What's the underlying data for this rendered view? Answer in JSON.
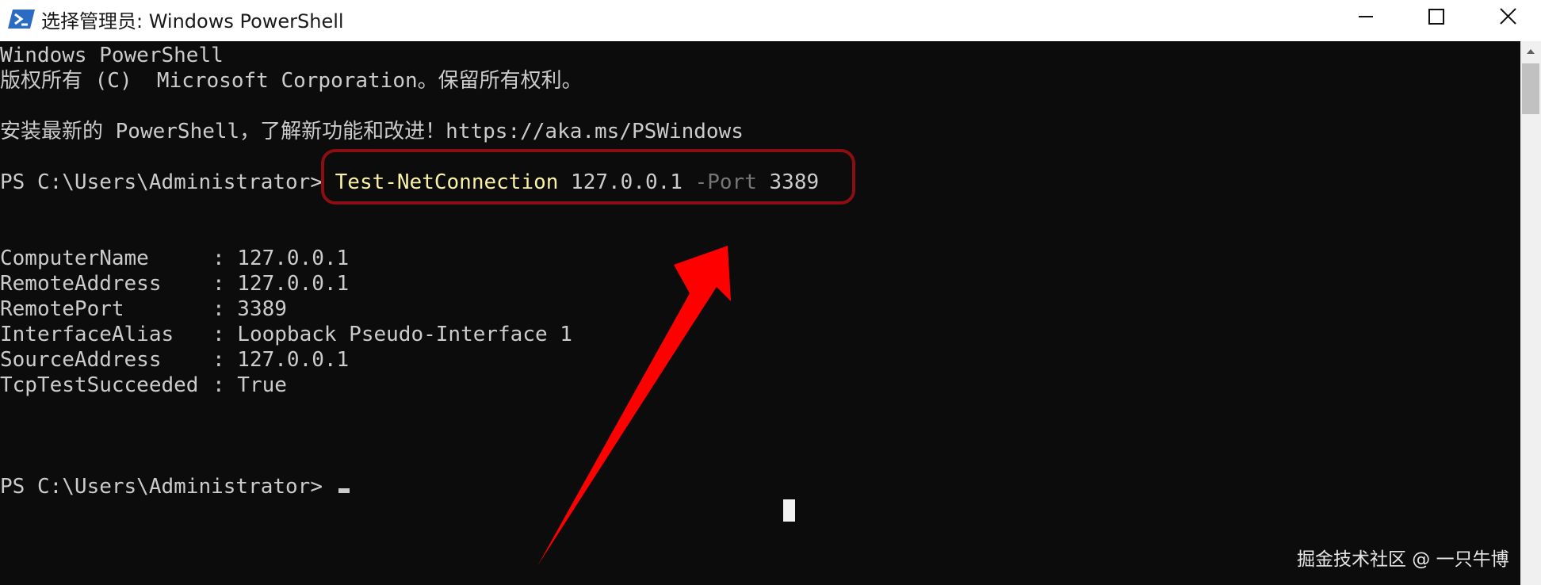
{
  "window": {
    "title": "选择管理员: Windows PowerShell",
    "icon": "powershell-icon",
    "controls": [
      "minimize-icon",
      "maximize-icon",
      "close-icon"
    ]
  },
  "terminal": {
    "header_line1": "Windows PowerShell",
    "header_line2": "版权所有 (C)  Microsoft Corporation。保留所有权利。",
    "install_hint": "安装最新的 PowerShell，了解新功能和改进！https://aka.ms/PSWindows",
    "prompt": "PS C:\\Users\\Administrator> ",
    "command": {
      "name": "Test-NetConnection",
      "target": " 127.0.0.1 ",
      "param": "-Port",
      "value": " 3389"
    },
    "result": [
      {
        "name": "ComputerName",
        "value": ": 127.0.0.1"
      },
      {
        "name": "RemoteAddress",
        "value": ": 127.0.0.1"
      },
      {
        "name": "RemotePort",
        "value": ": 3389"
      },
      {
        "name": "InterfaceAlias",
        "value": ": Loopback Pseudo-Interface 1"
      },
      {
        "name": "SourceAddress",
        "value": ": 127.0.0.1"
      },
      {
        "name": "TcpTestSucceeded",
        "value": ": True"
      }
    ],
    "final_prompt": "PS C:\\Users\\Administrator> "
  },
  "annotation": {
    "box_color": "#8b0f12",
    "arrow_color": "#ff0000"
  },
  "colors": {
    "background": "#0c0c0c",
    "text": "#cccccc",
    "command": "#f9f1a5",
    "parameter": "#767676"
  },
  "watermark": "掘金技术社区 @ 一只牛博"
}
